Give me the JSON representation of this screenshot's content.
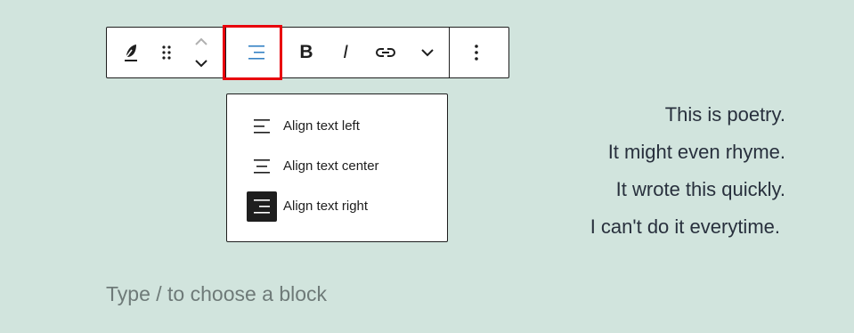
{
  "toolbar": {
    "buttons": [
      {
        "name": "block-type",
        "icon": "feather-icon"
      },
      {
        "name": "drag-handle",
        "icon": "drag-dots-icon"
      },
      {
        "name": "move-up",
        "icon": "chevron-up-icon"
      },
      {
        "name": "move-down",
        "icon": "chevron-down-icon"
      },
      {
        "name": "align",
        "icon": "align-right-icon"
      },
      {
        "name": "bold",
        "icon": "bold-icon"
      },
      {
        "name": "italic",
        "icon": "italic-icon"
      },
      {
        "name": "link",
        "icon": "link-icon"
      },
      {
        "name": "more-rich-text",
        "icon": "chevron-down-icon"
      },
      {
        "name": "options",
        "icon": "vertical-ellipsis-icon"
      }
    ],
    "bold_glyph": "B",
    "italic_glyph": "I",
    "accent_color": "#3582c4",
    "highlight_color": "#e8000b"
  },
  "align_menu": {
    "items": [
      {
        "label": "Align text left",
        "icon": "align-left-icon",
        "selected": false
      },
      {
        "label": "Align text center",
        "icon": "align-center-icon",
        "selected": false
      },
      {
        "label": "Align text right",
        "icon": "align-right-icon",
        "selected": true
      }
    ]
  },
  "poem": {
    "lines": [
      "This is poetry.",
      "It might even rhyme.",
      "It wrote this quickly.",
      "I can't do it everytime."
    ]
  },
  "editor": {
    "placeholder": "Type / to choose a block"
  },
  "colors": {
    "background": "#d1e4dd",
    "text": "#28303d"
  }
}
